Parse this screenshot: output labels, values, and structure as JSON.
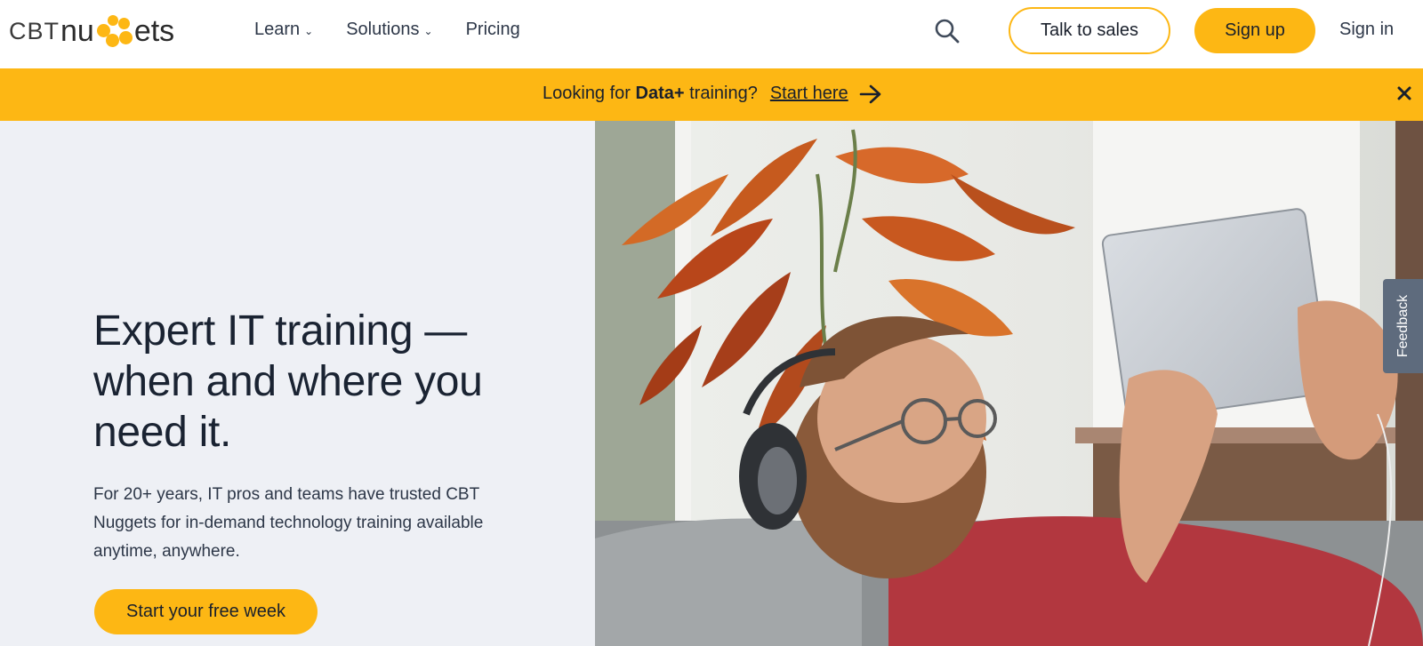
{
  "brand": {
    "logo_prefix": "CBT",
    "logo_part1": "nu",
    "logo_part2": "ets",
    "accent_color": "#fdb714"
  },
  "nav": {
    "items": [
      {
        "label": "Learn",
        "has_dropdown": true
      },
      {
        "label": "Solutions",
        "has_dropdown": true
      },
      {
        "label": "Pricing",
        "has_dropdown": false
      }
    ]
  },
  "header_actions": {
    "search_icon": "search-icon",
    "talk_to_sales": "Talk to sales",
    "sign_up": "Sign up",
    "sign_in": "Sign in"
  },
  "banner": {
    "text_before": "Looking for ",
    "text_bold": "Data+",
    "text_after": " training?",
    "link_label": "Start here",
    "arrow_icon": "arrow-right-icon",
    "close_icon": "close-icon"
  },
  "hero": {
    "title": "Expert IT training — when and where you need it.",
    "description": "For 20+ years, IT pros and teams have trusted CBT Nuggets for in-demand technology training available anytime, anywhere.",
    "cta_label": "Start your free week"
  },
  "feedback": {
    "label": "Feedback"
  }
}
